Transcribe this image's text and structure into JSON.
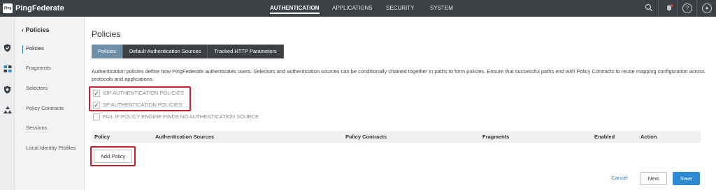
{
  "app": {
    "logo_text": "Ping",
    "brand": "PingFederate"
  },
  "topnav": {
    "items": [
      {
        "label": "AUTHENTICATION",
        "active": true
      },
      {
        "label": "APPLICATIONS",
        "active": false
      },
      {
        "label": "SECURITY",
        "active": false
      },
      {
        "label": "SYSTEM",
        "active": false
      }
    ],
    "icons": [
      "search-icon",
      "notifications-icon",
      "help-icon",
      "user-icon"
    ],
    "help_glyph": "?",
    "user_glyph": "●"
  },
  "rail": {
    "icons": [
      "shield-icon",
      "applications-icon",
      "security-badge-icon",
      "system-nodes-icon"
    ]
  },
  "sidebar": {
    "back_label": "Policies",
    "items": [
      {
        "label": "Policies",
        "active": true
      },
      {
        "label": "Fragments",
        "active": false
      },
      {
        "label": "Selectors",
        "active": false
      },
      {
        "label": "Policy Contracts",
        "active": false
      },
      {
        "label": "Sessions",
        "active": false
      },
      {
        "label": "Local Identity Profiles",
        "active": false
      }
    ]
  },
  "main": {
    "title": "Policies",
    "tabs": [
      {
        "label": "Policies",
        "active": true
      },
      {
        "label": "Default Authentication Sources",
        "active": false
      },
      {
        "label": "Tracked HTTP Parameters",
        "active": false
      }
    ],
    "description": "Authentication policies define how PingFederate authenticates users. Selectors and authentication sources can be conditionally chained together in paths to form policies. Ensure that successful paths end with Policy Contracts to reuse mapping configuration across protocols and applications.",
    "checkboxes": [
      {
        "label": "IDP AUTHENTICATION POLICIES",
        "checked": true
      },
      {
        "label": "SP AUTHENTICATION POLICIES",
        "checked": true
      },
      {
        "label": "FAIL IF POLICY ENGINE FINDS NO AUTHENTICATION SOURCE",
        "checked": false
      }
    ],
    "check_glyph": "✓",
    "table": {
      "columns": [
        "Policy",
        "Authentication Sources",
        "Policy Contracts",
        "Fragments",
        "Enabled",
        "Action"
      ]
    },
    "add_policy_label": "Add Policy"
  },
  "footer": {
    "cancel_label": "Cancel",
    "next_label": "Next",
    "save_label": "Save"
  },
  "colors": {
    "topbar": "#3c4045",
    "accent": "#2e8ad2",
    "active_tab": "#6f8fa8",
    "highlight": "#c8202a"
  }
}
